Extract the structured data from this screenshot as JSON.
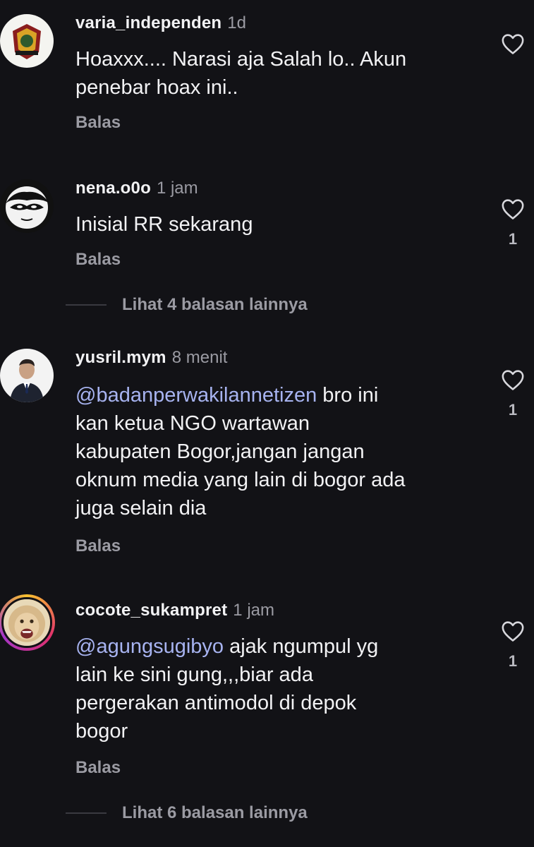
{
  "comments": [
    {
      "username": "varia_independen",
      "time": "1d",
      "text_lines": [
        "Hoaxxx.... Narasi aja Salah lo.. Akun",
        "penebar hoax ini.."
      ],
      "reply_label": "Balas",
      "likes": ""
    },
    {
      "username": "nena.o0o",
      "time": "1 jam",
      "text_lines": [
        "Inisial RR sekarang"
      ],
      "reply_label": "Balas",
      "likes": "1",
      "more_replies": "Lihat 4 balasan lainnya"
    },
    {
      "username": "yusril.mym",
      "time": "8 menit",
      "mention": "@badanperwakilannetizen",
      "text_first": " bro ini",
      "text_lines": [
        "kan ketua NGO wartawan",
        "kabupaten Bogor,jangan jangan",
        "oknum media yang lain di bogor ada",
        "juga selain dia"
      ],
      "reply_label": "Balas",
      "likes": "1"
    },
    {
      "username": "cocote_sukampret",
      "time": "1 jam",
      "mention": "@agungsugibyo",
      "text_first": " ajak ngumpul yg",
      "text_lines": [
        "lain ke sini gung,,,biar ada",
        "pergerakan antimodol di depok",
        "bogor"
      ],
      "reply_label": "Balas",
      "likes": "1",
      "more_replies": "Lihat 6 balasan lainnya"
    }
  ],
  "colors": {
    "background": "#121216",
    "mention": "#a7b3f0",
    "secondary_text": "#9b9ba3"
  },
  "icons": [
    "emblem-avatar",
    "masked-face-avatar",
    "portrait-avatar",
    "monkey-avatar",
    "heart-icon"
  ]
}
